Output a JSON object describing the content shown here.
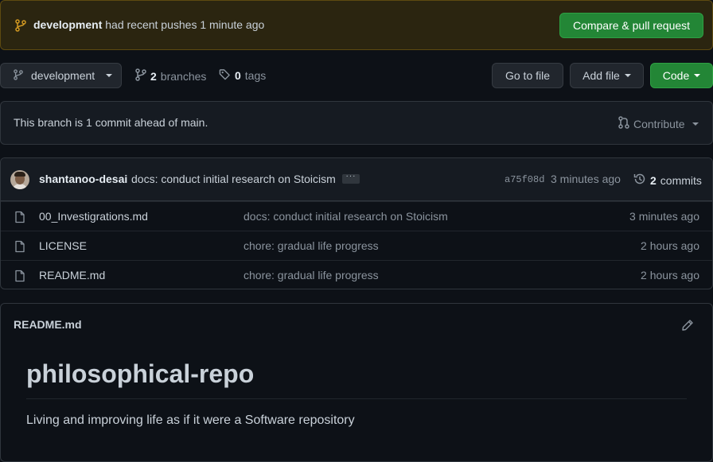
{
  "banner": {
    "branch": "development",
    "message": "had recent pushes 1 minute ago",
    "compare_button": "Compare & pull request"
  },
  "toolbar": {
    "branch_select": "development",
    "branches_count": "2",
    "branches_label": "branches",
    "tags_count": "0",
    "tags_label": "tags",
    "go_to_file": "Go to file",
    "add_file": "Add file",
    "code": "Code"
  },
  "ahead": {
    "text": "This branch is 1 commit ahead of main.",
    "contribute": "Contribute"
  },
  "latest_commit": {
    "author": "shantanoo-desai",
    "message": "docs: conduct initial research on Stoicism",
    "ellipsis": "···",
    "sha": "a75f08d",
    "time": "3 minutes ago",
    "commits_count": "2",
    "commits_label": "commits"
  },
  "files": [
    {
      "name": "00_Investigrations.md",
      "commit": "docs: conduct initial research on Stoicism",
      "age": "3 minutes ago"
    },
    {
      "name": "LICENSE",
      "commit": "chore: gradual life progress",
      "age": "2 hours ago"
    },
    {
      "name": "README.md",
      "commit": "chore: gradual life progress",
      "age": "2 hours ago"
    }
  ],
  "readme": {
    "filename": "README.md",
    "heading": "philosophical-repo",
    "body": "Living and improving life as if it were a Software repository"
  },
  "icons": {
    "branch": "git-branch-icon",
    "tag": "tag-icon",
    "pull_request": "git-pull-request-icon",
    "history": "history-icon",
    "file": "file-icon",
    "edit": "pencil-icon"
  },
  "colors": {
    "primary_button": "#238636",
    "banner_bg": "#2b2510",
    "banner_icon": "#d29922"
  }
}
